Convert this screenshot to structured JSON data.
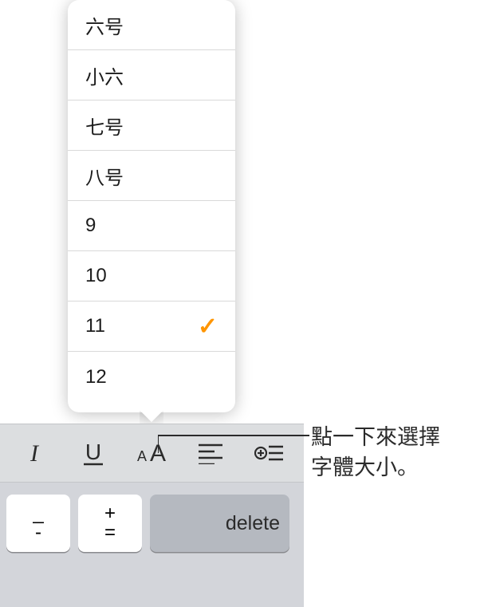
{
  "fontSizeMenu": {
    "items": [
      {
        "label": "六号",
        "selected": false
      },
      {
        "label": "小六",
        "selected": false
      },
      {
        "label": "七号",
        "selected": false
      },
      {
        "label": "八号",
        "selected": false
      },
      {
        "label": "9",
        "selected": false
      },
      {
        "label": "10",
        "selected": false
      },
      {
        "label": "11",
        "selected": true
      },
      {
        "label": "12",
        "selected": false
      }
    ]
  },
  "toolbar": {
    "italic": "I",
    "underline": "U",
    "fontSize": "aA",
    "align": "align",
    "insert": "insert"
  },
  "keyboard": {
    "minus_top": "_",
    "minus_bottom": "-",
    "plus": "+",
    "eq": "=",
    "delete": "delete"
  },
  "callout": {
    "line1": "點一下來選擇",
    "line2": "字體大小。"
  }
}
